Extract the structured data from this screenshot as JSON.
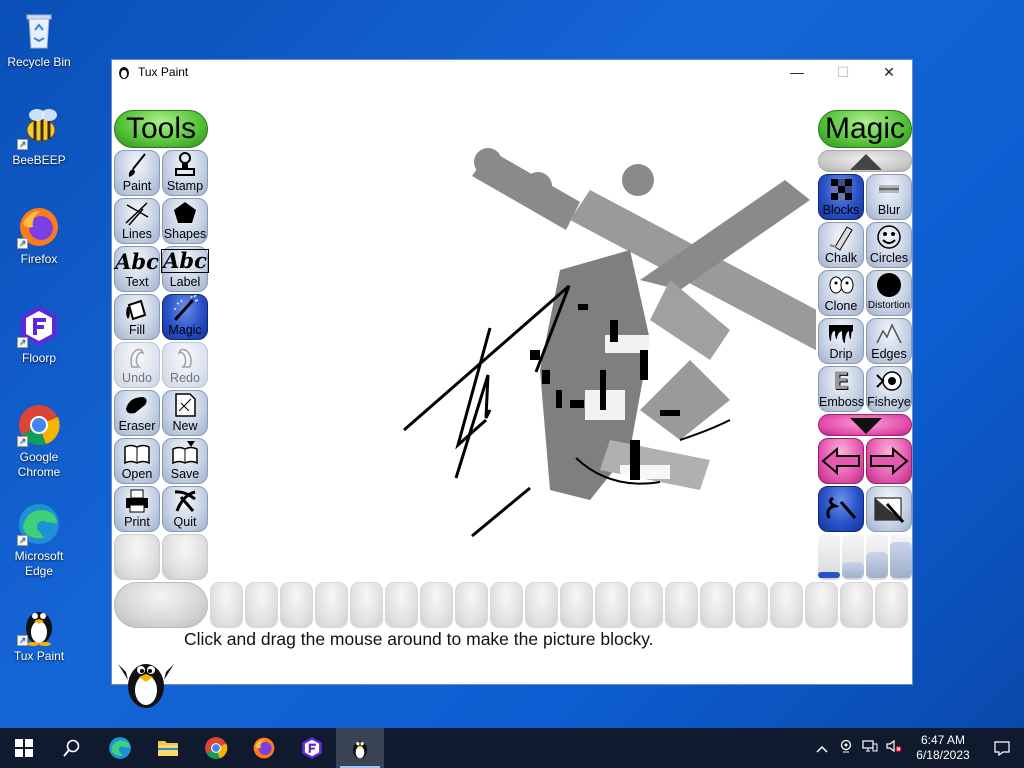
{
  "desktop": {
    "icons": [
      {
        "label": "Recycle Bin",
        "icon": "recycle-bin-icon"
      },
      {
        "label": "BeeBEEP",
        "icon": "bee-icon"
      },
      {
        "label": "Firefox",
        "icon": "firefox-icon"
      },
      {
        "label": "Floorp",
        "icon": "floorp-icon"
      },
      {
        "label": "Google Chrome",
        "icon": "chrome-icon"
      },
      {
        "label": "Microsoft Edge",
        "icon": "edge-icon"
      },
      {
        "label": "Tux Paint",
        "icon": "tux-icon"
      }
    ]
  },
  "window": {
    "title": "Tux Paint",
    "minimize": "—",
    "maximize": "☐",
    "close": "✕"
  },
  "tools": {
    "header": "Tools",
    "items": [
      {
        "label": "Paint",
        "icon": "brush-icon"
      },
      {
        "label": "Stamp",
        "icon": "stamp-icon"
      },
      {
        "label": "Lines",
        "icon": "lines-icon"
      },
      {
        "label": "Shapes",
        "icon": "pentagon-icon"
      },
      {
        "label": "Text",
        "icon": "text-icon",
        "glyph": "Abc"
      },
      {
        "label": "Label",
        "icon": "label-icon",
        "glyph": "Abc"
      },
      {
        "label": "Fill",
        "icon": "paint-bucket-icon"
      },
      {
        "label": "Magic",
        "icon": "magic-wand-icon",
        "selected": true
      },
      {
        "label": "Undo",
        "icon": "undo-icon",
        "disabled": true
      },
      {
        "label": "Redo",
        "icon": "redo-icon",
        "disabled": true
      },
      {
        "label": "Eraser",
        "icon": "eraser-icon"
      },
      {
        "label": "New",
        "icon": "new-page-icon"
      },
      {
        "label": "Open",
        "icon": "open-book-icon"
      },
      {
        "label": "Save",
        "icon": "save-book-icon"
      },
      {
        "label": "Print",
        "icon": "printer-icon"
      },
      {
        "label": "Quit",
        "icon": "quit-icon"
      }
    ]
  },
  "magic": {
    "header": "Magic",
    "items": [
      {
        "label": "Blocks",
        "icon": "blocks-icon",
        "selected": true
      },
      {
        "label": "Blur",
        "icon": "blur-icon"
      },
      {
        "label": "Chalk",
        "icon": "chalk-icon"
      },
      {
        "label": "Circles",
        "icon": "circles-icon"
      },
      {
        "label": "Clone",
        "icon": "clone-icon"
      },
      {
        "label": "Distortion",
        "icon": "distortion-icon"
      },
      {
        "label": "Drip",
        "icon": "drip-icon"
      },
      {
        "label": "Edges",
        "icon": "edges-icon"
      },
      {
        "label": "Emboss",
        "icon": "emboss-icon",
        "glyph": "E"
      },
      {
        "label": "Fisheye",
        "icon": "fisheye-icon"
      }
    ]
  },
  "status_tip": "Click and drag the mouse around to make the picture blocky.",
  "taskbar": {
    "apps": [
      {
        "name": "start",
        "icon": "windows-start-icon"
      },
      {
        "name": "search",
        "icon": "search-icon"
      },
      {
        "name": "edge",
        "icon": "edge-icon"
      },
      {
        "name": "file-explorer",
        "icon": "folder-icon"
      },
      {
        "name": "chrome",
        "icon": "chrome-icon"
      },
      {
        "name": "firefox",
        "icon": "firefox-icon"
      },
      {
        "name": "floorp",
        "icon": "floorp-icon"
      },
      {
        "name": "tux-paint",
        "icon": "tux-icon",
        "active": true
      }
    ],
    "time": "6:47 AM",
    "date": "6/18/2023"
  }
}
